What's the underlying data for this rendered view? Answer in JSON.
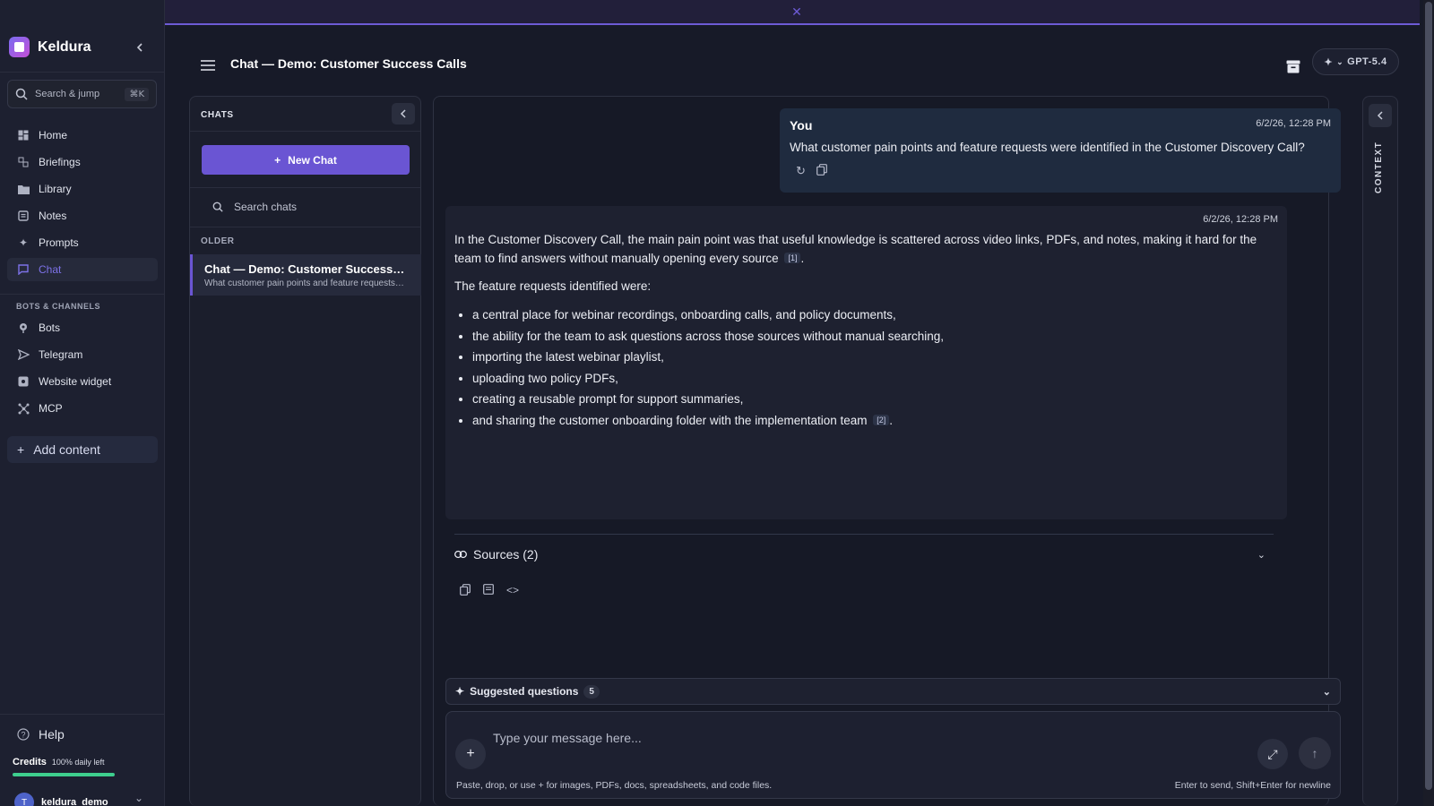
{
  "announcement": {
    "text": "",
    "close_icon": "close-icon"
  },
  "app": {
    "name": "Keldura"
  },
  "sidebar": {
    "search_label": "Search & jump",
    "search_shortcut": "⌘K",
    "nav": [
      {
        "label": "Home",
        "icon": "home-icon"
      },
      {
        "label": "Briefings",
        "icon": "briefings-icon"
      },
      {
        "label": "Library",
        "icon": "folder-icon"
      },
      {
        "label": "Notes",
        "icon": "notes-icon"
      },
      {
        "label": "Prompts",
        "icon": "sparkle-icon"
      },
      {
        "label": "Chat",
        "icon": "chat-icon",
        "active": true
      }
    ],
    "section_bots": "BOTS & CHANNELS",
    "bots_nav": [
      {
        "label": "Bots",
        "icon": "bot-icon"
      },
      {
        "label": "Telegram",
        "icon": "telegram-icon"
      },
      {
        "label": "Website widget",
        "icon": "widget-icon"
      },
      {
        "label": "MCP",
        "icon": "mcp-icon"
      }
    ],
    "add_content": "Add content",
    "help": "Help",
    "credits_label": "Credits",
    "credits_value": "100% daily left",
    "credits_fraction": 1.0,
    "user": {
      "initial": "T",
      "name": "keldura_demo"
    }
  },
  "header": {
    "title": "Chat — Demo: Customer Success Calls",
    "model": "GPT-5.4"
  },
  "chats_panel": {
    "title": "CHATS",
    "new_chat": "New Chat",
    "search_placeholder": "Search chats",
    "group_label": "OLDER",
    "items": [
      {
        "title": "Chat — Demo: Customer Success Calls",
        "preview": "What customer pain points and feature requests were identified in the Customer Discovery Call?"
      }
    ]
  },
  "conversation": {
    "user_message": {
      "author": "You",
      "time": "6/2/26, 12:28 PM",
      "text": "What customer pain points and feature requests were identified in the Customer Discovery Call?"
    },
    "assistant_message": {
      "time": "6/2/26, 12:28 PM",
      "para1": "In the Customer Discovery Call, the main pain point was that useful knowledge is scattered across video links, PDFs, and notes, making it hard for the team to find answers without manually opening every source",
      "cite1": "[1]",
      "para2": "The feature requests identified were:",
      "bullets": [
        "a central place for webinar recordings, onboarding calls, and policy documents,",
        "the ability for the team to ask questions across those sources without manual searching,",
        "importing the latest webinar playlist,",
        "uploading two policy PDFs,",
        "creating a reusable prompt for support summaries,",
        "and sharing the customer onboarding folder with the implementation team"
      ],
      "cite2": "[2]",
      "sources_label": "Sources (2)"
    }
  },
  "suggested": {
    "label": "Suggested questions",
    "count": "5"
  },
  "composer": {
    "placeholder": "Type your message here...",
    "hint_left": "Paste, drop, or use + for images, PDFs, docs, spreadsheets, and code files.",
    "hint_right": "Enter to send, Shift+Enter for newline"
  },
  "context_panel": {
    "label": "CONTEXT"
  },
  "colors": {
    "accent": "#6a55d3",
    "background": "#171a28",
    "credits": "#3ecf8e"
  }
}
